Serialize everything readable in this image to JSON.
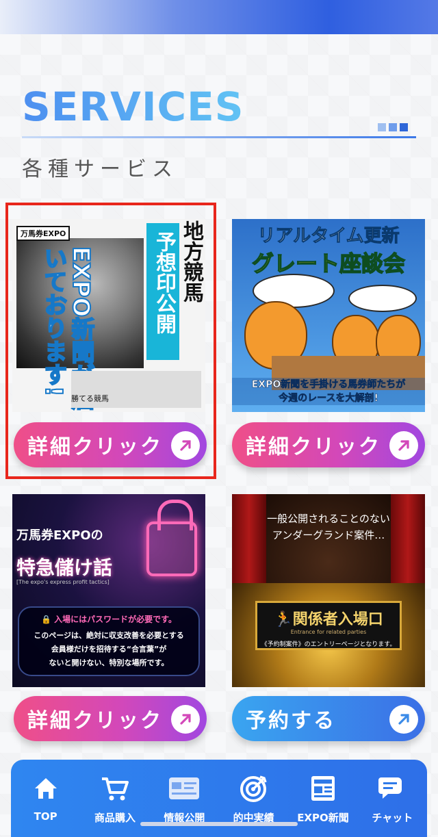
{
  "section": {
    "title": "SERVICES",
    "subtitle": "各種サービス"
  },
  "cards": [
    {
      "image": {
        "logo": "万馬券EXPO",
        "headline_vertical": "地方競馬",
        "badge_vertical": "予想印公開",
        "side_vertical": "EXPO新聞が届いております!",
        "caption": "勝てる競馬"
      },
      "button_label": "詳細クリック",
      "button_style": "pink",
      "highlighted": true
    },
    {
      "image": {
        "headline_1": "リアルタイム更新",
        "headline_2": "グレート座談会",
        "caption_1": "EXPO新聞を手掛ける馬券師たちが",
        "caption_2": "今週のレースを大解剖!"
      },
      "button_label": "詳細クリック",
      "button_style": "pink"
    },
    {
      "image": {
        "logo": "万馬券EXPOの",
        "title": "特急儲け話",
        "subtitle": "[The expo's express profit tactics]",
        "notice": "入場にはパスワードが必要です。",
        "line_1": "このページは、絶対に収支改善を必要とする",
        "line_2": "会員様だけを招待する“合言葉”が",
        "line_3": "ないと開けない、特別な場所です。"
      },
      "button_label": "詳細クリック",
      "button_style": "pink"
    },
    {
      "image": {
        "top_1": "一般公開されることのない",
        "top_2": "アンダーグランド案件…",
        "plate_title": "関係者入場口",
        "plate_sub": "Entrance for related parties",
        "plate_note": "《予約制案件》のエントリーページとなります。"
      },
      "button_label": "予約する",
      "button_style": "blue"
    }
  ],
  "nav": [
    {
      "label": "TOP",
      "icon": "home-icon"
    },
    {
      "label": "商品購入",
      "icon": "cart-icon"
    },
    {
      "label": "情報公開",
      "icon": "card-icon"
    },
    {
      "label": "的中実績",
      "icon": "target-icon"
    },
    {
      "label": "EXPO新聞",
      "icon": "newspaper-icon"
    },
    {
      "label": "チャット",
      "icon": "chat-icon"
    }
  ],
  "colors": {
    "accent_blue": "#2f6fe8",
    "button_pink_start": "#ef4f88",
    "button_pink_end": "#a147e0",
    "highlight_red": "#e8261c"
  }
}
